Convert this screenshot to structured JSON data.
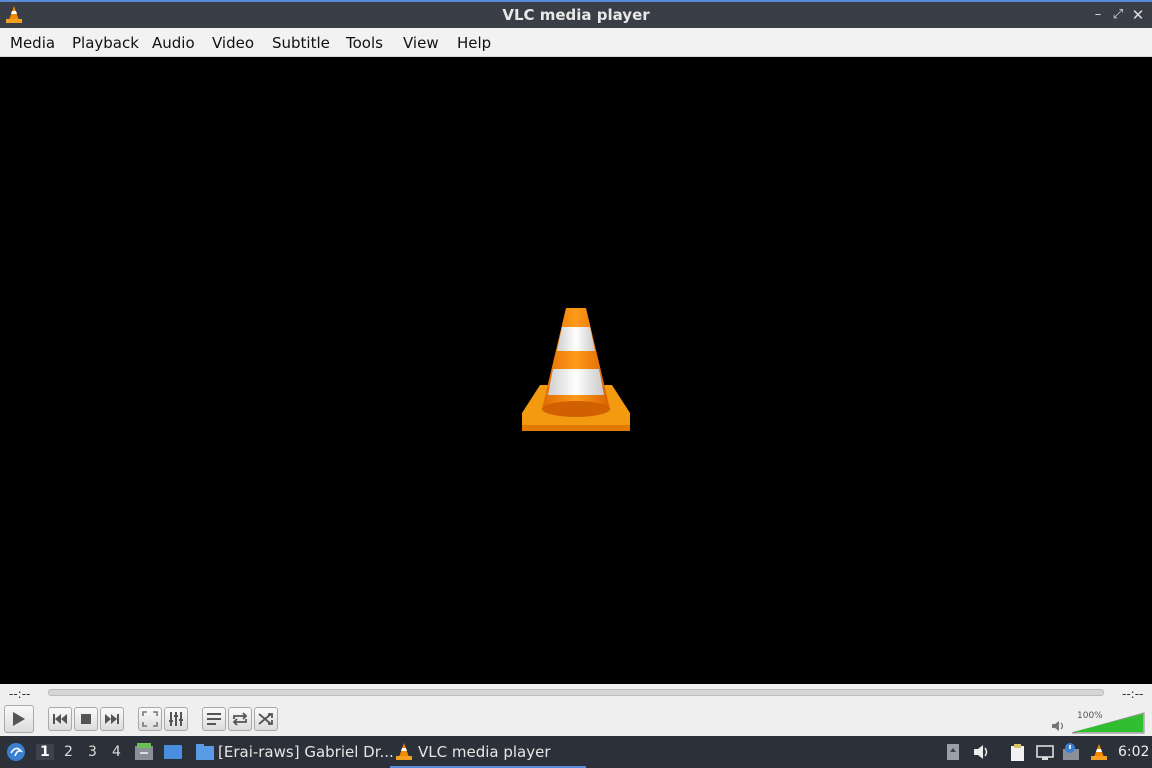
{
  "window": {
    "title": "VLC media player"
  },
  "menu": [
    "Media",
    "Playback",
    "Audio",
    "Video",
    "Subtitle",
    "Tools",
    "View",
    "Help"
  ],
  "controls": {
    "time_elapsed": "--:--",
    "time_total": "--:--",
    "volume_label": "100%",
    "volume_level": 1.0
  },
  "taskbar": {
    "workspaces": [
      "1",
      "2",
      "3",
      "4"
    ],
    "tasks": [
      {
        "label": "[Erai-raws] Gabriel Dr..."
      },
      {
        "label": "VLC media player"
      }
    ],
    "clock": "6:02"
  },
  "colors": {
    "accent": "#5a8bd6",
    "cone_orange": "#f08a00",
    "volume_green": "#2fbf2f"
  }
}
